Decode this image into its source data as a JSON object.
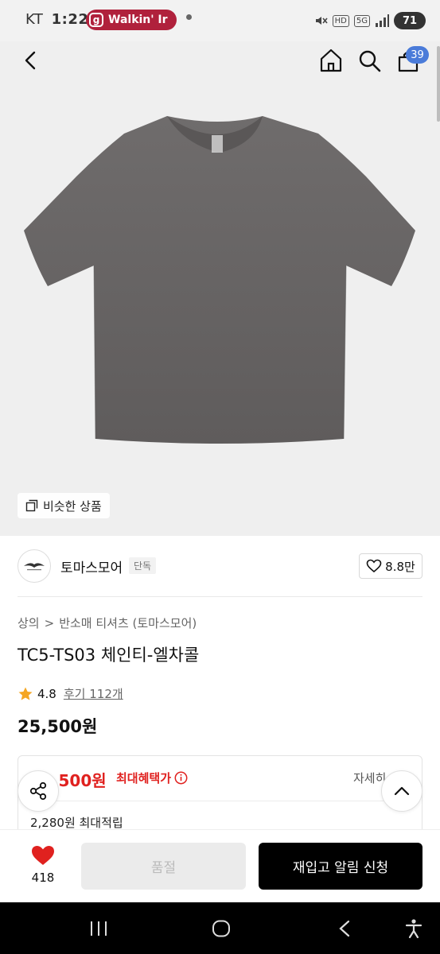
{
  "status_bar": {
    "carrier": "KT",
    "time": "1:22",
    "notification_app_initial": "g",
    "notification_text": "Walkin' Ir",
    "hd_label": "HD",
    "network_label": "5G",
    "battery": "71"
  },
  "header": {
    "back_icon": "chevron-left-icon",
    "home_icon": "home-icon",
    "search_icon": "search-icon",
    "cart_icon": "shopping-bag-icon",
    "cart_count": "39"
  },
  "hero": {
    "similar_label": "비슷한 상품"
  },
  "brand": {
    "name": "토마스모어",
    "tag": "단독",
    "like_count": "8.8만"
  },
  "breadcrumb": {
    "category": "상의",
    "separator": ">",
    "subcategory": "반소매 티셔츠 (토마스모어)"
  },
  "product": {
    "title": "TC5-TS03 체인티-엘차콜",
    "rating": "4.8",
    "review_label": "후기 112개",
    "price": "25,500원"
  },
  "benefit": {
    "max_price": "5,500원",
    "max_price_label": "최대혜택가",
    "detail_label": "자세히",
    "points": "2,280원 최대적립"
  },
  "action_bar": {
    "heart_count": "418",
    "soldout_label": "품절",
    "restock_label": "재입고 알림 신청"
  },
  "colors": {
    "accent_red": "#e0211f",
    "badge_blue": "#4a7bd9",
    "notif_pill": "#b0213c",
    "shirt": "#6b6868"
  }
}
